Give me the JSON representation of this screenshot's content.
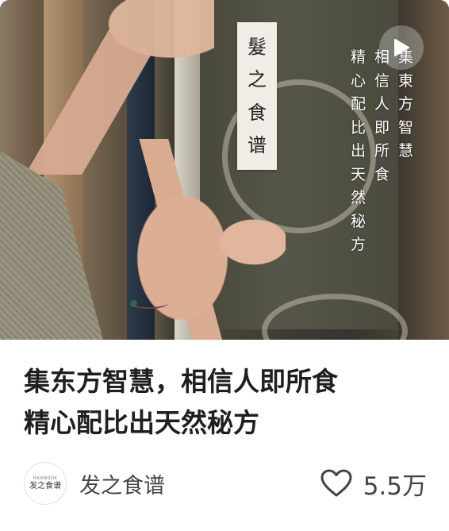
{
  "media": {
    "label_chars": [
      "髮",
      "之",
      "食",
      "谱"
    ],
    "overlay_columns": [
      [
        "集",
        "東",
        "方",
        "智",
        "慧"
      ],
      [
        "相",
        "信",
        "人",
        "即",
        "所",
        "食"
      ],
      [
        "精",
        "心",
        "配",
        "比",
        "出",
        "天",
        "然",
        "秘",
        "方"
      ]
    ],
    "play_icon": "play-icon"
  },
  "post": {
    "title_line_1": "集东方智慧，相信人即所食",
    "title_line_2": "精心配比出天然秘方"
  },
  "author": {
    "avatar_subtext": "HAIRBOOK",
    "avatar_text": "发之食谱",
    "name": "发之食谱"
  },
  "likes": {
    "icon": "heart-icon",
    "count": "5.5万"
  },
  "colors": {
    "title": "#1f1f1f",
    "meta": "#444444",
    "background": "#ffffff"
  }
}
